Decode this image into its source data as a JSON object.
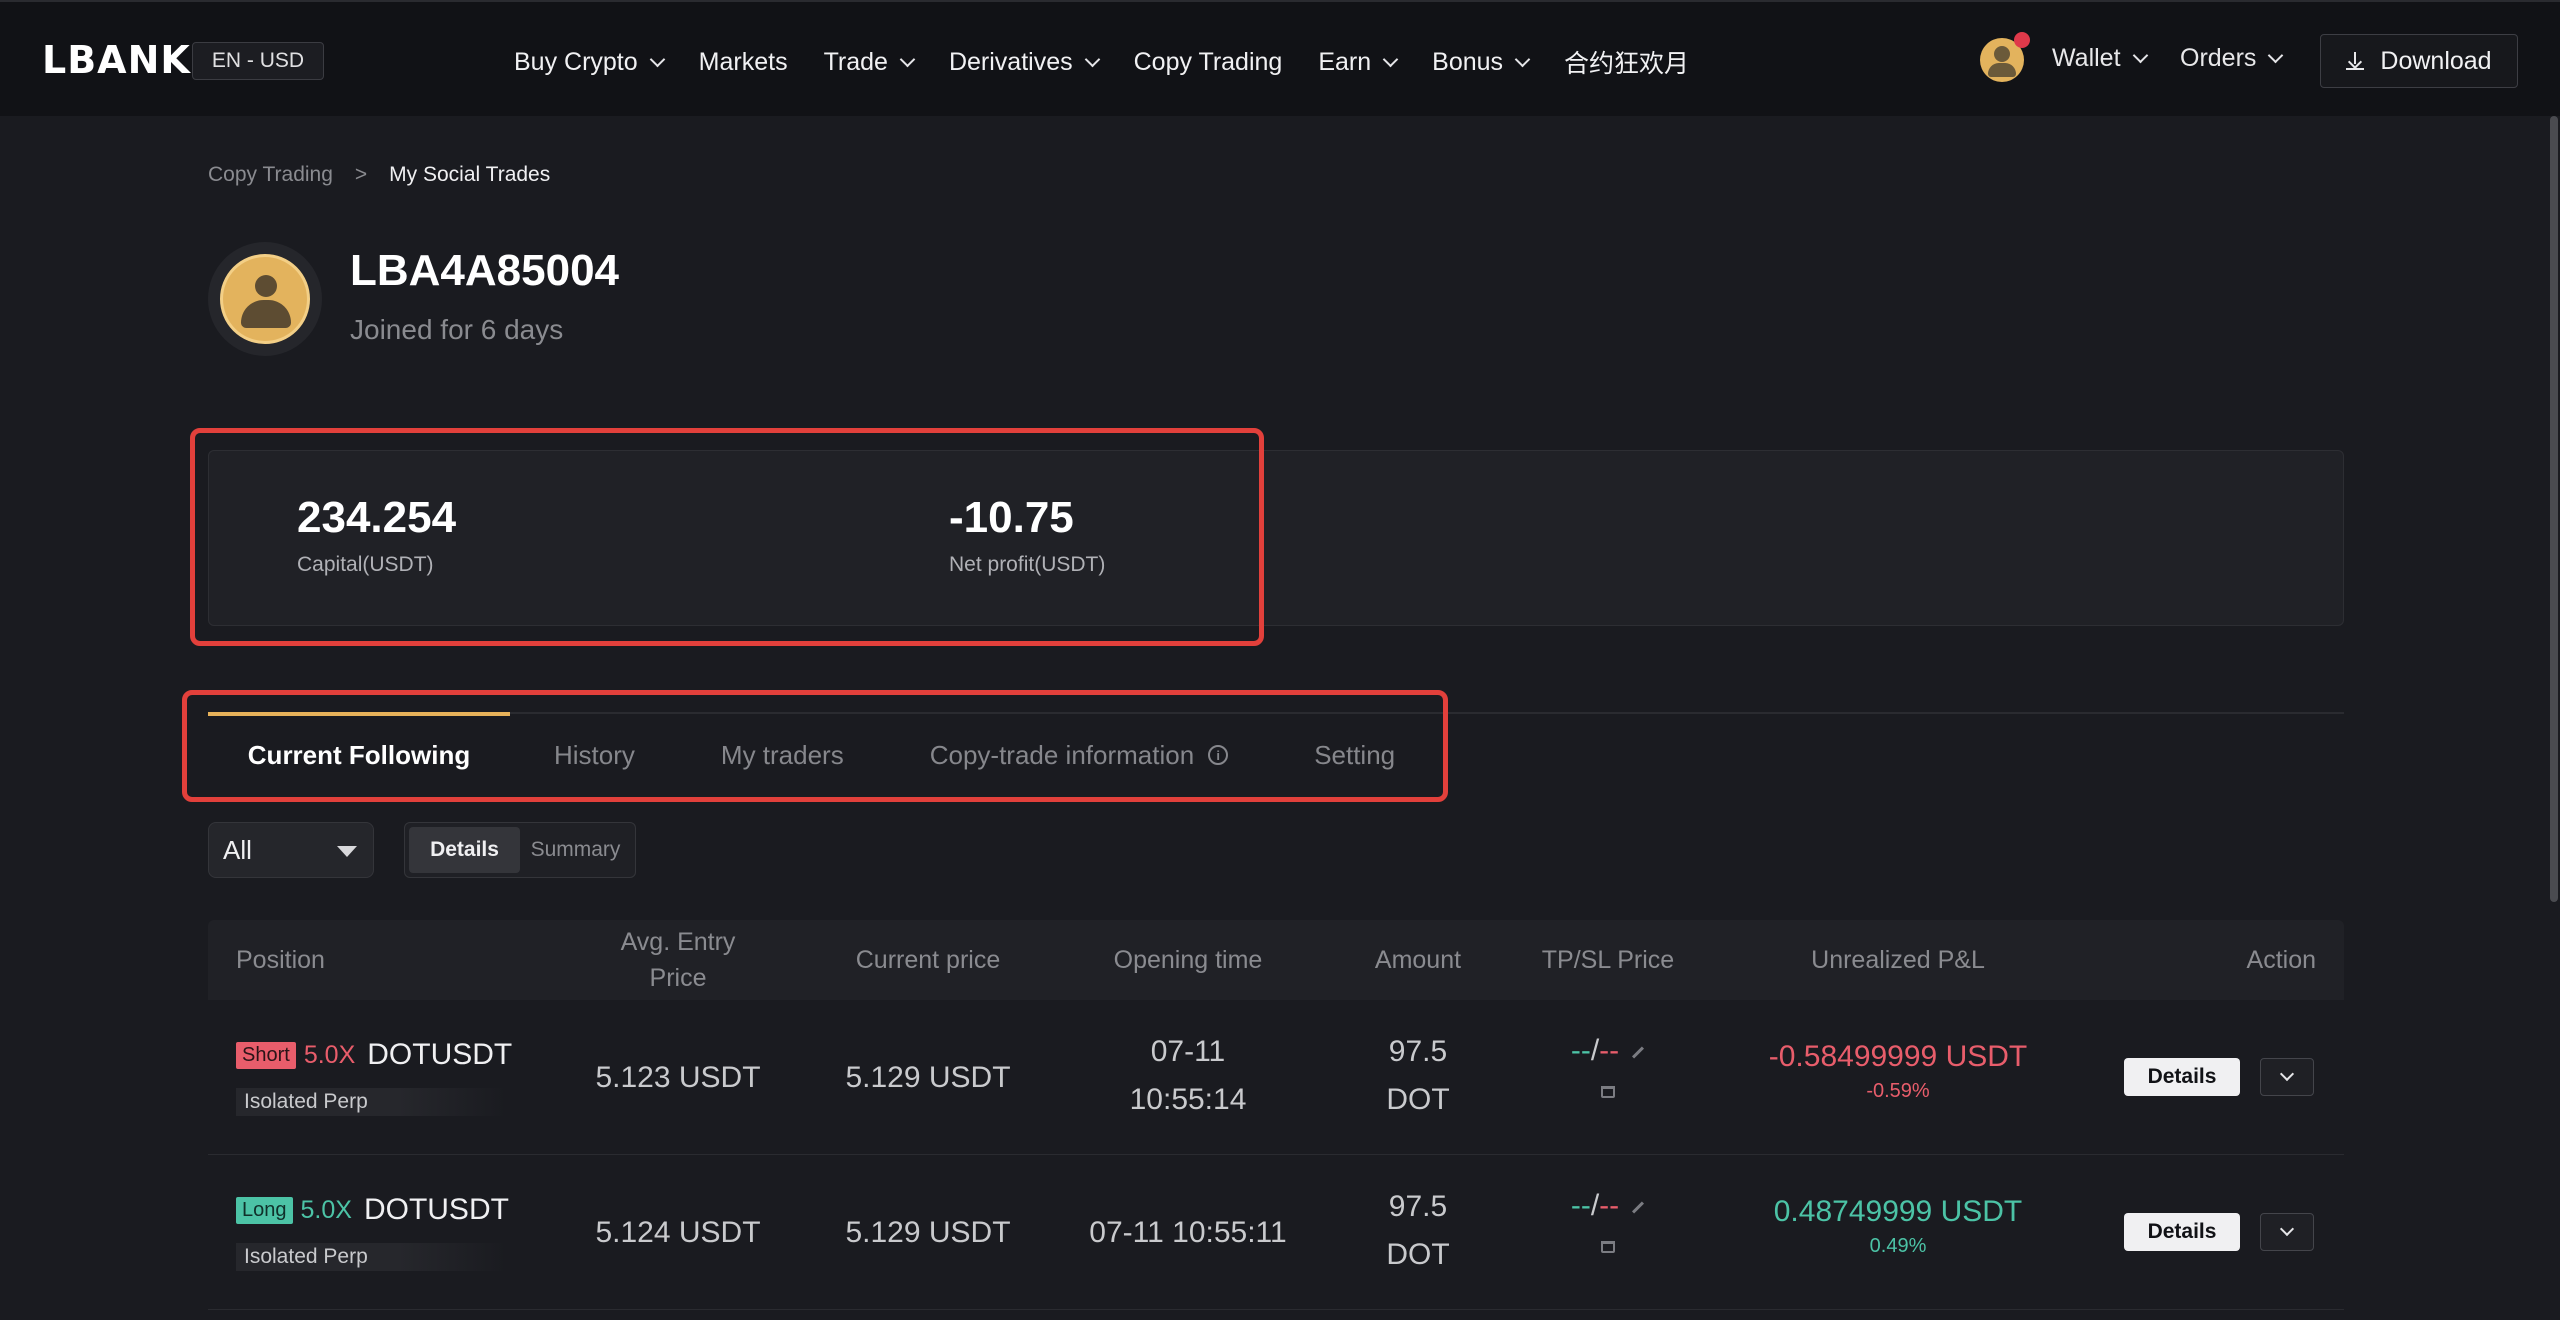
{
  "header": {
    "logo": "LBANK",
    "language": "EN - USD",
    "nav": [
      {
        "label": "Buy Crypto",
        "dropdown": true
      },
      {
        "label": "Markets",
        "dropdown": false
      },
      {
        "label": "Trade",
        "dropdown": true
      },
      {
        "label": "Derivatives",
        "dropdown": true
      },
      {
        "label": "Copy Trading",
        "dropdown": false
      },
      {
        "label": "Earn",
        "dropdown": true
      },
      {
        "label": "Bonus",
        "dropdown": true
      },
      {
        "label": "合约狂欢月",
        "dropdown": false
      }
    ],
    "wallet": "Wallet",
    "orders": "Orders",
    "download": "Download"
  },
  "breadcrumb": {
    "parent": "Copy Trading",
    "separator": ">",
    "current": "My Social Trades"
  },
  "profile": {
    "username": "LBA4A85004",
    "joined": "Joined for 6 days"
  },
  "stats": {
    "capital_value": "234.254",
    "capital_label": "Capital(USDT)",
    "net_profit_value": "-10.75",
    "net_profit_label": "Net profit(USDT)"
  },
  "tabs": [
    {
      "label": "Current Following",
      "active": true
    },
    {
      "label": "History",
      "active": false
    },
    {
      "label": "My traders",
      "active": false
    },
    {
      "label": "Copy-trade information",
      "active": false,
      "info_icon": true
    },
    {
      "label": "Setting",
      "active": false
    }
  ],
  "filters": {
    "select_value": "All",
    "segment": [
      "Details",
      "Summary"
    ],
    "segment_active": "Details"
  },
  "table": {
    "headers": {
      "position": "Position",
      "entry_line1": "Avg. Entry",
      "entry_line2": "Price",
      "current": "Current price",
      "opening": "Opening time",
      "amount": "Amount",
      "tpsl": "TP/SL Price",
      "pnl": "Unrealized P&L",
      "action": "Action"
    },
    "rows": [
      {
        "side": "Short",
        "leverage": "5.0X",
        "symbol": "DOTUSDT",
        "margin": "Isolated  Perp",
        "entry": "5.123 USDT",
        "current": "5.129 USDT",
        "opening_line1": "07-11",
        "opening_line2": "10:55:14",
        "amount_line1": "97.5",
        "amount_line2": "DOT",
        "tp": "--",
        "tpsl_sep": "/",
        "sl": "--",
        "pnl": "-0.58499999 USDT",
        "pnl_pct": "-0.59%",
        "details": "Details"
      },
      {
        "side": "Long",
        "leverage": "5.0X",
        "symbol": "DOTUSDT",
        "margin": "Isolated  Perp",
        "entry": "5.124 USDT",
        "current": "5.129 USDT",
        "opening_line1": "07-11 10:55:11",
        "opening_line2": "",
        "amount_line1": "97.5",
        "amount_line2": "DOT",
        "tp": "--",
        "tpsl_sep": "/",
        "sl": "--",
        "pnl": "0.48749999 USDT",
        "pnl_pct": "0.49%",
        "details": "Details"
      }
    ]
  },
  "colors": {
    "accent": "#e7b25a",
    "loss": "#e85d6b",
    "profit": "#4cc3a6",
    "highlight_box": "#e2403b"
  }
}
